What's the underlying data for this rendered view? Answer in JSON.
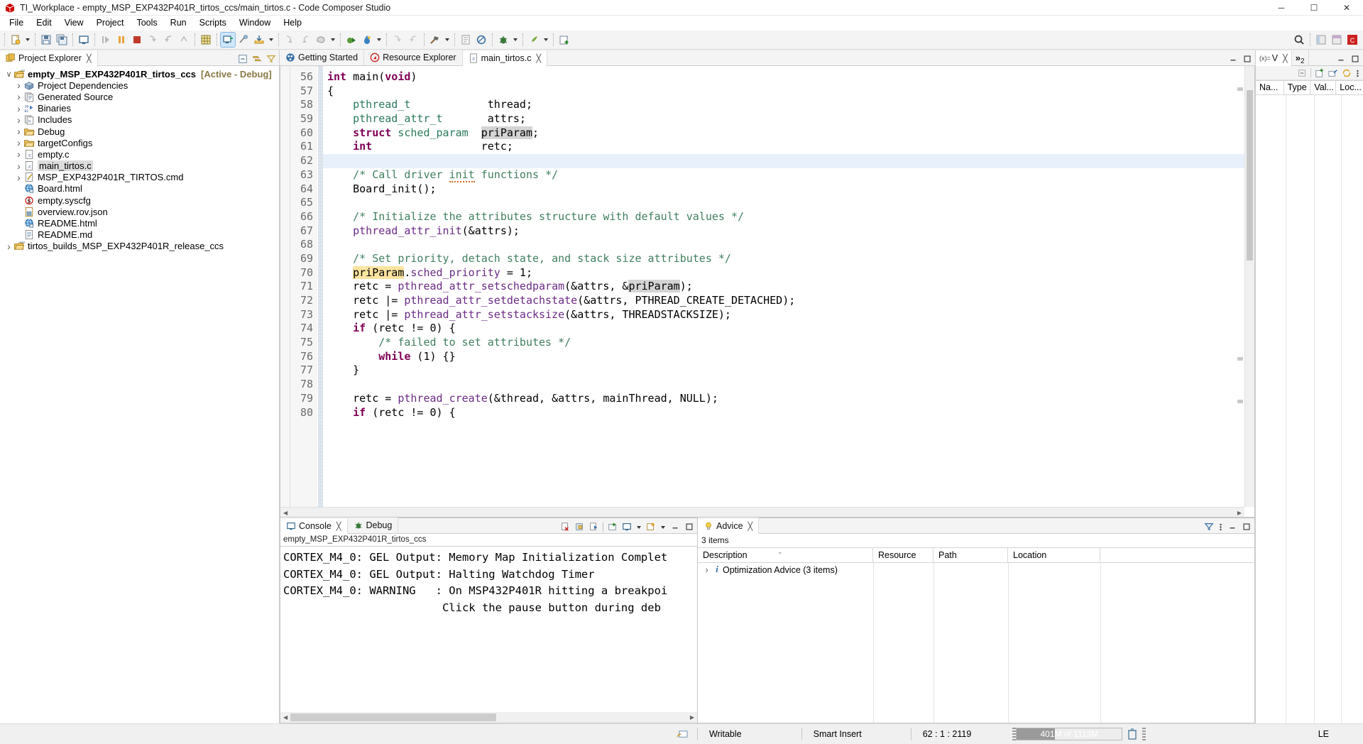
{
  "window": {
    "title": "TI_Workplace - empty_MSP_EXP432P401R_tirtos_ccs/main_tirtos.c - Code Composer Studio",
    "minimize": "─",
    "maximize": "☐",
    "close": "✕"
  },
  "menu": {
    "items": [
      "File",
      "Edit",
      "View",
      "Project",
      "Tools",
      "Run",
      "Scripts",
      "Window",
      "Help"
    ]
  },
  "toolbar": {
    "icons": [
      "new-file-icon",
      "new-file-dropdown-icon",
      "save-icon",
      "save-all-icon",
      "open-console-icon",
      "resume-icon",
      "suspend-icon",
      "terminate-icon",
      "step-into-icon",
      "step-over-icon",
      "step-return-icon",
      "grid-icon",
      "restart-icon",
      "connect-target-icon",
      "load-program-icon",
      "load-program-dropdown-icon",
      "disassembly-step-icon",
      "disassembly-step2-icon",
      "cache-icon",
      "cache-dropdown-icon",
      "debug-run-icon",
      "build-icon",
      "build-dropdown-icon",
      "step-back-icon",
      "step-forward-icon",
      "hammer-build-icon",
      "hammer-dropdown-icon",
      "properties-icon",
      "search-resource-icon",
      "debug-bug-icon",
      "debug-dropdown-icon",
      "run-rocket-icon",
      "run-dropdown-icon",
      "new-project-icon"
    ],
    "right_icons": [
      "search-icon",
      "perspective-java-icon",
      "perspective-debug-icon",
      "perspective-ccs-icon"
    ]
  },
  "explorer": {
    "tab_label": "Project Explorer",
    "tab_icon": "project-explorer-icon",
    "close_icon": "close-icon",
    "view_buttons": [
      "collapse-all-icon",
      "link-with-editor-icon",
      "view-menu-filter-icon"
    ],
    "tree": [
      {
        "label": "empty_MSP_EXP432P401R_tirtos_ccs",
        "suffix": "[Active - Debug]",
        "icon": "ccs-project-icon",
        "twisty": "open",
        "indent": 0,
        "bold": true,
        "selected": false
      },
      {
        "label": "Project Dependencies",
        "suffix": "",
        "icon": "dependencies-icon",
        "twisty": "closed",
        "indent": 1,
        "bold": false,
        "selected": false
      },
      {
        "label": "Generated Source",
        "suffix": "",
        "icon": "generated-source-icon",
        "twisty": "closed",
        "indent": 1,
        "bold": false,
        "selected": false
      },
      {
        "label": "Binaries",
        "suffix": "",
        "icon": "binaries-icon",
        "twisty": "closed",
        "indent": 1,
        "bold": false,
        "selected": false
      },
      {
        "label": "Includes",
        "suffix": "",
        "icon": "includes-icon",
        "twisty": "closed",
        "indent": 1,
        "bold": false,
        "selected": false
      },
      {
        "label": "Debug",
        "suffix": "",
        "icon": "folder-icon",
        "twisty": "closed",
        "indent": 1,
        "bold": false,
        "selected": false
      },
      {
        "label": "targetConfigs",
        "suffix": "",
        "icon": "folder-icon",
        "twisty": "closed",
        "indent": 1,
        "bold": false,
        "selected": false
      },
      {
        "label": "empty.c",
        "suffix": "",
        "icon": "c-file-icon",
        "twisty": "closed",
        "indent": 1,
        "bold": false,
        "selected": false
      },
      {
        "label": "main_tirtos.c",
        "suffix": "",
        "icon": "c-file-icon",
        "twisty": "closed",
        "indent": 1,
        "bold": false,
        "selected": true
      },
      {
        "label": "MSP_EXP432P401R_TIRTOS.cmd",
        "suffix": "",
        "icon": "cmd-file-icon",
        "twisty": "closed",
        "indent": 1,
        "bold": false,
        "selected": false
      },
      {
        "label": "Board.html",
        "suffix": "",
        "icon": "html-file-icon",
        "twisty": "none",
        "indent": 1,
        "bold": false,
        "selected": false
      },
      {
        "label": "empty.syscfg",
        "suffix": "",
        "icon": "syscfg-file-icon",
        "twisty": "none",
        "indent": 1,
        "bold": false,
        "selected": false
      },
      {
        "label": "overview.rov.json",
        "suffix": "",
        "icon": "json-file-icon",
        "twisty": "none",
        "indent": 1,
        "bold": false,
        "selected": false
      },
      {
        "label": "README.html",
        "suffix": "",
        "icon": "html-file-icon",
        "twisty": "none",
        "indent": 1,
        "bold": false,
        "selected": false
      },
      {
        "label": "README.md",
        "suffix": "",
        "icon": "md-file-icon",
        "twisty": "none",
        "indent": 1,
        "bold": false,
        "selected": false
      },
      {
        "label": "tirtos_builds_MSP_EXP432P401R_release_ccs",
        "suffix": "",
        "icon": "rtsc-project-icon",
        "twisty": "closed",
        "indent": 0,
        "bold": false,
        "selected": false
      }
    ]
  },
  "editor": {
    "tabs": [
      {
        "label": "Getting Started",
        "icon": "getting-started-icon",
        "selected": false,
        "closeable": false
      },
      {
        "label": "Resource Explorer",
        "icon": "resource-explorer-icon",
        "selected": false,
        "closeable": false
      },
      {
        "label": "main_tirtos.c",
        "icon": "c-file-icon",
        "selected": true,
        "closeable": true
      }
    ],
    "close_icon": "close-icon",
    "minimize_icon": "minimize-icon",
    "maximize_icon": "maximize-icon",
    "first_line": 56,
    "lines": [
      {
        "n": 56,
        "cur": false,
        "tokens": [
          {
            "t": "int ",
            "c": "kw"
          },
          {
            "t": "main",
            "c": "pl"
          },
          {
            "t": "(",
            "c": "pl"
          },
          {
            "t": "void",
            "c": "kw"
          },
          {
            "t": ")",
            "c": "pl"
          }
        ]
      },
      {
        "n": 57,
        "cur": false,
        "tokens": [
          {
            "t": "{",
            "c": "pl"
          }
        ]
      },
      {
        "n": 58,
        "cur": false,
        "tokens": [
          {
            "t": "    ",
            "c": "pl"
          },
          {
            "t": "pthread_t",
            "c": "ty"
          },
          {
            "t": "            ",
            "c": "pl"
          },
          {
            "t": "thread;",
            "c": "pl"
          }
        ]
      },
      {
        "n": 59,
        "cur": false,
        "tokens": [
          {
            "t": "    ",
            "c": "pl"
          },
          {
            "t": "pthread_attr_t",
            "c": "ty"
          },
          {
            "t": "       ",
            "c": "pl"
          },
          {
            "t": "attrs;",
            "c": "pl"
          }
        ]
      },
      {
        "n": 60,
        "cur": false,
        "tokens": [
          {
            "t": "    ",
            "c": "pl"
          },
          {
            "t": "struct",
            "c": "kw"
          },
          {
            "t": " ",
            "c": "pl"
          },
          {
            "t": "sched_param",
            "c": "ty"
          },
          {
            "t": "  ",
            "c": "pl"
          },
          {
            "t": "priParam",
            "c": "occ"
          },
          {
            "t": ";",
            "c": "pl"
          }
        ]
      },
      {
        "n": 61,
        "cur": false,
        "tokens": [
          {
            "t": "    ",
            "c": "pl"
          },
          {
            "t": "int",
            "c": "kw"
          },
          {
            "t": "                 ",
            "c": "pl"
          },
          {
            "t": "retc;",
            "c": "pl"
          }
        ]
      },
      {
        "n": 62,
        "cur": true,
        "tokens": [
          {
            "t": "",
            "c": "pl"
          }
        ]
      },
      {
        "n": 63,
        "cur": false,
        "tokens": [
          {
            "t": "    /* Call driver ",
            "c": "cm"
          },
          {
            "t": "init",
            "c": "cm sq"
          },
          {
            "t": " functions */",
            "c": "cm"
          }
        ]
      },
      {
        "n": 64,
        "cur": false,
        "tokens": [
          {
            "t": "    Board_init();",
            "c": "pl"
          }
        ]
      },
      {
        "n": 65,
        "cur": false,
        "tokens": [
          {
            "t": "",
            "c": "pl"
          }
        ]
      },
      {
        "n": 66,
        "cur": false,
        "tokens": [
          {
            "t": "    /* Initialize the attributes structure with default values */",
            "c": "cm"
          }
        ]
      },
      {
        "n": 67,
        "cur": false,
        "tokens": [
          {
            "t": "    ",
            "c": "pl"
          },
          {
            "t": "pthread_attr_init",
            "c": "fn"
          },
          {
            "t": "(&attrs);",
            "c": "pl"
          }
        ]
      },
      {
        "n": 68,
        "cur": false,
        "tokens": [
          {
            "t": "",
            "c": "pl"
          }
        ]
      },
      {
        "n": 69,
        "cur": false,
        "tokens": [
          {
            "t": "    /* Set priority, detach state, and stack size attributes */",
            "c": "cm"
          }
        ]
      },
      {
        "n": 70,
        "cur": false,
        "tokens": [
          {
            "t": "    ",
            "c": "pl"
          },
          {
            "t": "priParam",
            "c": "wr"
          },
          {
            "t": ".",
            "c": "pl"
          },
          {
            "t": "sched_priority",
            "c": "fn"
          },
          {
            "t": " = 1;",
            "c": "pl"
          }
        ]
      },
      {
        "n": 71,
        "cur": false,
        "tokens": [
          {
            "t": "    retc = ",
            "c": "pl"
          },
          {
            "t": "pthread_attr_setschedparam",
            "c": "fn"
          },
          {
            "t": "(&attrs, &",
            "c": "pl"
          },
          {
            "t": "priParam",
            "c": "occ"
          },
          {
            "t": ");",
            "c": "pl"
          }
        ]
      },
      {
        "n": 72,
        "cur": false,
        "tokens": [
          {
            "t": "    retc |= ",
            "c": "pl"
          },
          {
            "t": "pthread_attr_setdetachstate",
            "c": "fn"
          },
          {
            "t": "(&attrs, ",
            "c": "pl"
          },
          {
            "t": "PTHREAD_CREATE_DETACHED",
            "c": "pl"
          },
          {
            "t": ");",
            "c": "pl"
          }
        ]
      },
      {
        "n": 73,
        "cur": false,
        "tokens": [
          {
            "t": "    retc |= ",
            "c": "pl"
          },
          {
            "t": "pthread_attr_setstacksize",
            "c": "fn"
          },
          {
            "t": "(&attrs, THREADSTACKSIZE);",
            "c": "pl"
          }
        ]
      },
      {
        "n": 74,
        "cur": false,
        "tokens": [
          {
            "t": "    ",
            "c": "pl"
          },
          {
            "t": "if",
            "c": "kw"
          },
          {
            "t": " (retc != 0) {",
            "c": "pl"
          }
        ]
      },
      {
        "n": 75,
        "cur": false,
        "tokens": [
          {
            "t": "        /* failed to set attributes */",
            "c": "cm"
          }
        ]
      },
      {
        "n": 76,
        "cur": false,
        "tokens": [
          {
            "t": "        ",
            "c": "pl"
          },
          {
            "t": "while",
            "c": "kw"
          },
          {
            "t": " (1) {}",
            "c": "pl"
          }
        ]
      },
      {
        "n": 77,
        "cur": false,
        "tokens": [
          {
            "t": "    }",
            "c": "pl"
          }
        ]
      },
      {
        "n": 78,
        "cur": false,
        "tokens": [
          {
            "t": "",
            "c": "pl"
          }
        ]
      },
      {
        "n": 79,
        "cur": false,
        "tokens": [
          {
            "t": "    retc = ",
            "c": "pl"
          },
          {
            "t": "pthread_create",
            "c": "fn"
          },
          {
            "t": "(&thread, &attrs, mainThread, NULL);",
            "c": "pl"
          }
        ]
      },
      {
        "n": 80,
        "cur": false,
        "tokens": [
          {
            "t": "    ",
            "c": "pl"
          },
          {
            "t": "if",
            "c": "kw"
          },
          {
            "t": " (retc != 0) {",
            "c": "pl"
          }
        ]
      }
    ]
  },
  "console": {
    "tabs": [
      {
        "label": "Console",
        "icon": "console-icon",
        "selected": true,
        "closeable": true
      },
      {
        "label": "Debug",
        "icon": "debug-icon",
        "selected": false,
        "closeable": false
      }
    ],
    "subtitle": "empty_MSP_EXP432P401R_tirtos_ccs",
    "toolbar_icons": [
      "clear-console-icon",
      "lock-scroll-icon",
      "show-console-icon",
      "open-console-icon",
      "display-selected-console-icon",
      "display-dropdown-icon",
      "new-console-icon",
      "new-console-dropdown-icon",
      "minimize-icon",
      "maximize-icon"
    ],
    "lines": [
      "CORTEX_M4_0: GEL Output: Memory Map Initialization Complet",
      "CORTEX_M4_0: GEL Output: Halting Watchdog Timer",
      "CORTEX_M4_0: WARNING   : On MSP432P401R hitting a breakpoi",
      "                        Click the pause button during deb"
    ]
  },
  "advice": {
    "tab_label": "Advice",
    "tab_icon": "advice-bulb-icon",
    "close_icon": "close-icon",
    "toolbar_icons": [
      "filter-icon",
      "view-menu-icon",
      "minimize-icon",
      "maximize-icon"
    ],
    "count_text": "3 items",
    "columns": [
      "Description",
      "Resource",
      "Path",
      "Location"
    ],
    "sort_indicator": "chevron-down-icon",
    "rows": [
      {
        "description": "Optimization Advice (3 items)",
        "resource": "",
        "path": "",
        "location": "",
        "icon": "info-icon",
        "twisty": "closed"
      }
    ]
  },
  "variables": {
    "tabs": [
      {
        "label": "V",
        "icon": "variables-icon",
        "selected": true,
        "closeable": true
      },
      {
        "label": "2",
        "icon": "overflow-tabs-icon",
        "selected": false,
        "closeable": false
      }
    ],
    "overflow_marker": "»",
    "minimize_icon": "minimize-icon",
    "maximize_icon": "maximize-icon",
    "toolbar_icons": [
      "collapse-all-icon",
      "new-expression-icon",
      "edit-expression-icon",
      "refresh-icon",
      "view-menu-icon"
    ],
    "columns": [
      "Na...",
      "Type",
      "Val...",
      "Loc..."
    ]
  },
  "statusbar": {
    "writable_icon": "writable-icon",
    "writable": "Writable",
    "insert_mode": "Smart Insert",
    "position": "62 : 1 : 2119",
    "heap_text": "401M of 1113M",
    "heap_percent": 36,
    "trash_icon": "trash-icon",
    "locale": "LE"
  },
  "colors": {
    "accent": "#0078d7",
    "keyword": "#7f0055",
    "comment": "#3f7f5f",
    "type": "#2a7a5a",
    "function": "#6b2a86",
    "occurrence_highlight": "#d4d4d4",
    "write_highlight": "#fbe4a0",
    "current_line": "#e8f1fb"
  }
}
